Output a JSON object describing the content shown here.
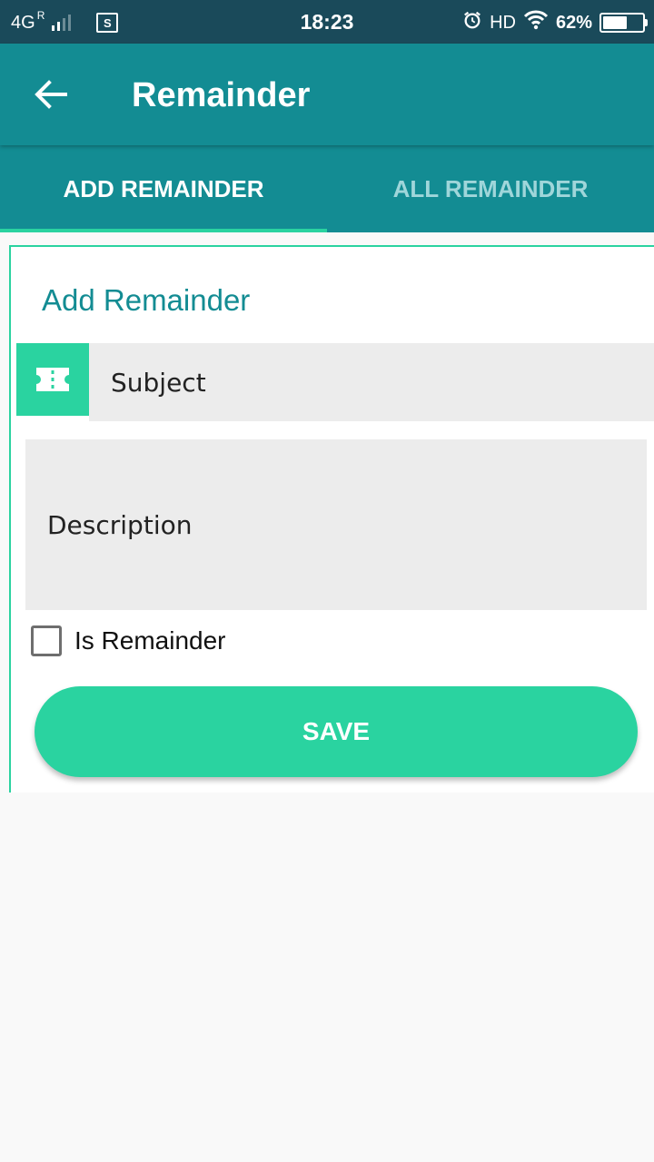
{
  "status_bar": {
    "network": "4G",
    "roaming": "R",
    "screenshot_icon": "screenshot-icon",
    "time": "18:23",
    "alarm_icon": "alarm-icon",
    "hd": "HD",
    "wifi_icon": "wifi-icon",
    "battery_percent": "62%",
    "battery_level": 0.62
  },
  "app_bar": {
    "back_icon": "arrow-left-icon",
    "title": "Remainder"
  },
  "tabs": [
    {
      "label": "ADD REMAINDER",
      "active": true
    },
    {
      "label": "ALL REMAINDER",
      "active": false
    }
  ],
  "form": {
    "title": "Add Remainder",
    "subject_icon": "ticket-icon",
    "subject_placeholder": "Subject",
    "description_placeholder": "Description",
    "checkbox_label": "Is Remainder",
    "checkbox_checked": false,
    "save_label": "SAVE"
  },
  "colors": {
    "status_bar": "#1a4a5a",
    "primary": "#138c93",
    "accent": "#2ad3a0",
    "input_bg": "#ececec",
    "inactive_tab_text": "#9fd6da"
  }
}
